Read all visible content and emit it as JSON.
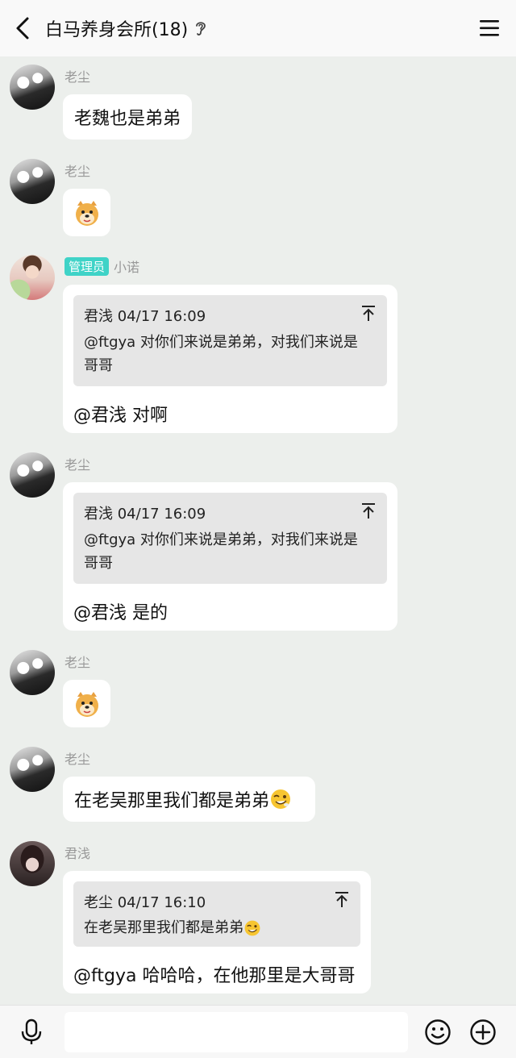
{
  "header": {
    "title": "白马养身会所(18)"
  },
  "messages": [
    {
      "sender": "老尘",
      "text": "老魏也是弟弟"
    },
    {
      "sender": "老尘",
      "sticker": "doge-sticker"
    },
    {
      "badge": "管理员",
      "sender": "小诺",
      "quote_author_time": "君浅 04/17 16:09",
      "quote_line1": "@ftgya 对你们来说是弟弟，对我们来说是",
      "quote_line2": "哥哥",
      "reply": "@君浅 对啊"
    },
    {
      "sender": "老尘",
      "quote_author_time": "君浅 04/17 16:09",
      "quote_line1": "@ftgya 对你们来说是弟弟，对我们来说是",
      "quote_line2": "哥哥",
      "reply": "@君浅 是的"
    },
    {
      "sender": "老尘",
      "sticker": "doge-sticker"
    },
    {
      "sender": "老尘",
      "text": "在老吴那里我们都是弟弟"
    },
    {
      "sender": "君浅",
      "quote_author_time": "老尘 04/17 16:10",
      "quote_line1": "在老吴那里我们都是弟弟",
      "reply": "@ftgya 哈哈哈，在他那里是大哥哥"
    }
  ],
  "colors": {
    "background": "#ecefec",
    "admin_badge": "#3fd3c7",
    "bubble": "#ffffff",
    "quote": "#e6e6e6"
  }
}
